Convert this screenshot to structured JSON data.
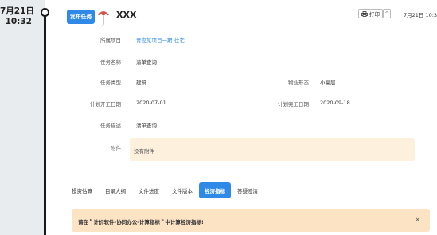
{
  "timeline": {
    "date": "7月21日",
    "time": "10:32"
  },
  "header": {
    "publish_label": "发布任务",
    "title": "XXX",
    "print_label": "打印",
    "collapse_symbol": "^",
    "date": "7月21日 10:32"
  },
  "fields": {
    "project": {
      "label": "所属项目",
      "value": "青岛某项目一期-住宅"
    },
    "task_name": {
      "label": "任务名称",
      "value": "清单查询"
    },
    "task_type": {
      "label": "任务类型",
      "value": "建筑"
    },
    "property_form": {
      "label": "物业形态",
      "value": "小高层"
    },
    "plan_start": {
      "label": "计划开工日期",
      "value": "2020-07-01"
    },
    "plan_end": {
      "label": "计划完工日期",
      "value": "2020-09-18"
    },
    "description": {
      "label": "任务描述",
      "value": "清单查询"
    },
    "attachment": {
      "label": "附件",
      "value": "没有附件"
    }
  },
  "tabs": [
    {
      "label": "投资估算",
      "active": false
    },
    {
      "label": "目录大纲",
      "active": false
    },
    {
      "label": "文件进度",
      "active": false
    },
    {
      "label": "文件版本",
      "active": false
    },
    {
      "label": "经济指标",
      "active": true
    },
    {
      "label": "答疑澄清",
      "active": false
    }
  ],
  "alert": {
    "message": "请在＂计价软件-协同办公-计算指标＂中计算经济指标!",
    "close_symbol": "×"
  },
  "colors": {
    "primary": "#2e8ae6",
    "attachment_bg": "#fdf0dd",
    "alert_bg": "#fce3c4",
    "timeline_bg": "#e8ecef"
  }
}
